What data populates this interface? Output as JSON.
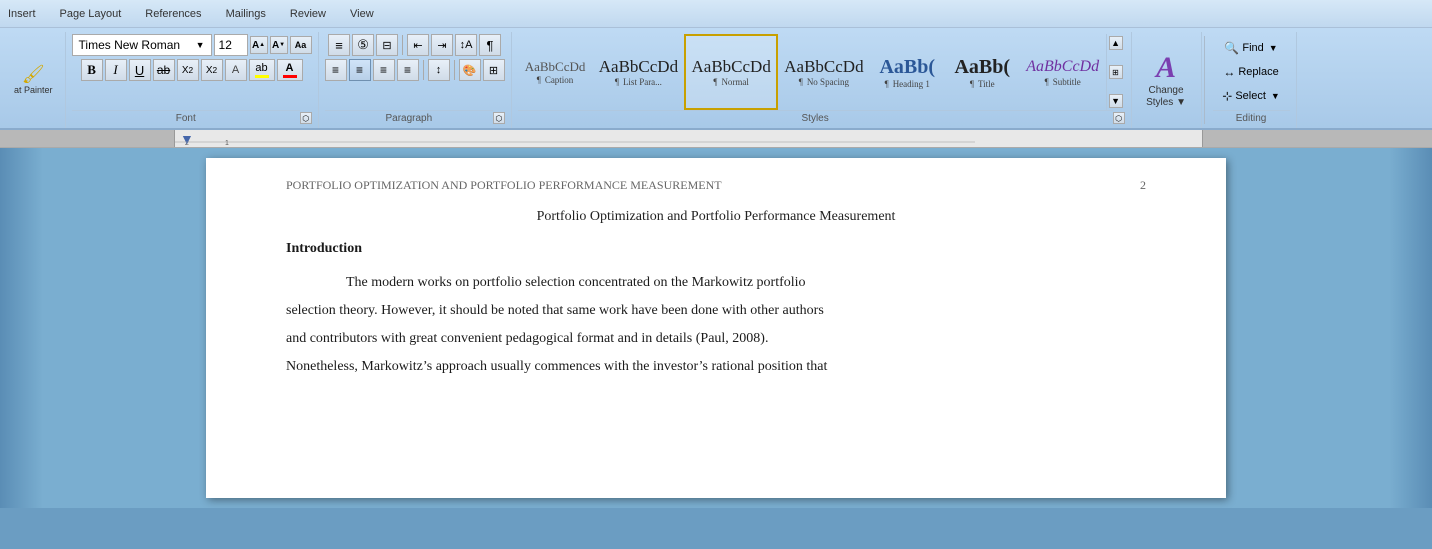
{
  "ribbon": {
    "tabs": [
      "Insert",
      "Page Layout",
      "References",
      "Mailings",
      "Review",
      "View"
    ],
    "font_group": {
      "label": "Font",
      "font_name": "Times New Roman",
      "font_size": "12",
      "expand_title": "Font dialog"
    },
    "paragraph_group": {
      "label": "Paragraph",
      "expand_title": "Paragraph dialog"
    },
    "styles_group": {
      "label": "Styles",
      "items": [
        {
          "id": "caption",
          "preview": "AaBbCcDd",
          "label": "Caption",
          "class": "style-caption",
          "active": false
        },
        {
          "id": "listpara",
          "preview": "AaBbCcDd",
          "label": "List Para...",
          "class": "style-listpara",
          "active": false
        },
        {
          "id": "normal",
          "preview": "AaBbCcDd",
          "label": "Normal",
          "class": "style-normal",
          "active": true
        },
        {
          "id": "nospacing",
          "preview": "AaBbCcDd",
          "label": "No Spacing",
          "class": "style-nospacing",
          "active": false
        },
        {
          "id": "heading1",
          "preview": "AaBb(",
          "label": "Heading 1",
          "class": "style-heading1",
          "active": false
        },
        {
          "id": "title",
          "preview": "AaBb(",
          "label": "Title",
          "class": "style-title",
          "active": false
        },
        {
          "id": "subtitle",
          "preview": "AaBbCcDd",
          "label": "Subtitle",
          "class": "style-subtitle",
          "active": false
        }
      ],
      "expand_title": "Styles dialog"
    },
    "change_styles": {
      "icon": "A",
      "label": "Change\nStyles",
      "dropdown": true
    },
    "editing_group": {
      "label": "Editing",
      "find": "Find",
      "replace": "Replace",
      "select": "Select"
    }
  },
  "document": {
    "header_text": "PORTFOLIO OPTIMIZATION AND PORTFOLIO PERFORMANCE MEASUREMENT",
    "header_page": "2",
    "title": "Portfolio Optimization and Portfolio Performance Measurement",
    "section_heading": "Introduction",
    "paragraph1_indent": "The modern works on portfolio selection concentrated on the Markowitz portfolio",
    "paragraph1_cont1": "selection theory. However, it should be noted that same work have been done with other authors",
    "paragraph1_cont2": "and contributors with great convenient pedagogical format and in details (Paul, 2008).",
    "paragraph1_cont3": "Nonetheless, Markowitz’s approach usually commences with the investor’s rational position that"
  },
  "format_painter": {
    "label": "at Painter"
  }
}
